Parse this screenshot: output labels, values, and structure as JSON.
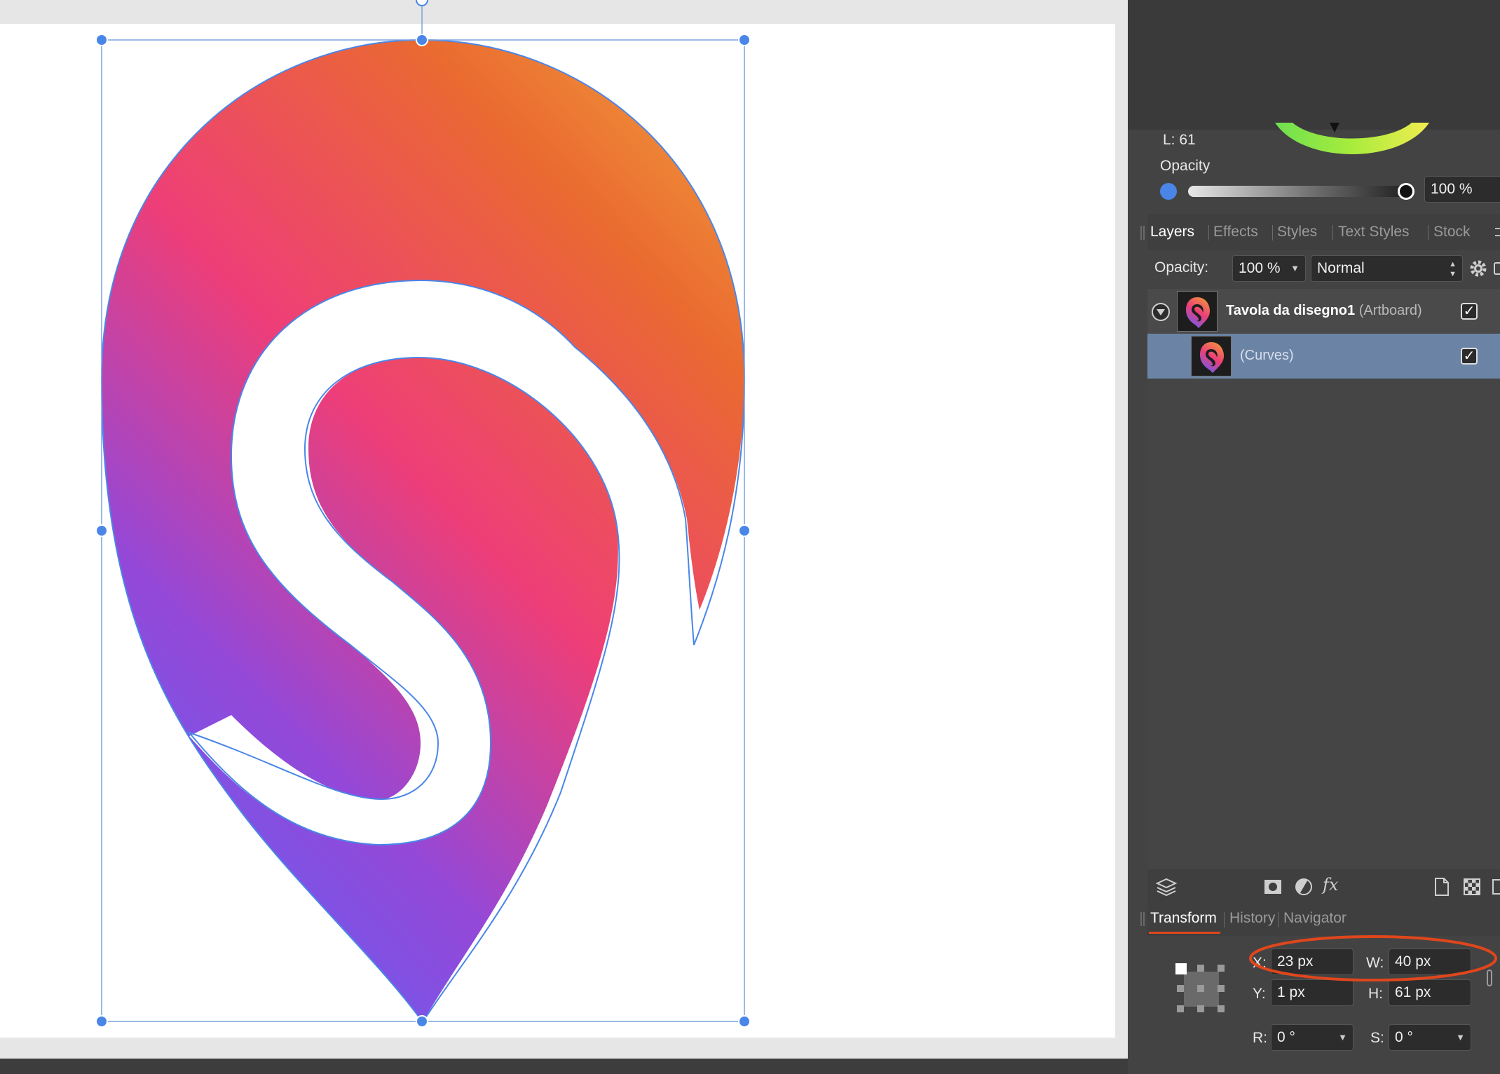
{
  "colors": {
    "accent_blue": "#4a86e8",
    "panel_bg": "#434343",
    "selected_row": "#6b84a6",
    "highlight_ring": "#e0461c",
    "gradient_top": "#f0953a",
    "gradient_mid": "#ee3e78",
    "gradient_bottom": "#6a5cf0"
  },
  "colour": {
    "lightness_label": "L: 61",
    "opacity_label": "Opacity",
    "opacity_value": "100 %"
  },
  "layers_tabs": [
    {
      "label": "Layers",
      "active": true
    },
    {
      "label": "Effects",
      "active": false
    },
    {
      "label": "Styles",
      "active": false
    },
    {
      "label": "Text Styles",
      "active": false
    },
    {
      "label": "Stock",
      "active": false
    }
  ],
  "layers_controls": {
    "opacity_label": "Opacity:",
    "opacity_value": "100 %",
    "blend_mode": "Normal"
  },
  "layers": [
    {
      "name": "Tavola da disegno1",
      "type": "(Artboard)",
      "visible": true,
      "expanded": true
    },
    {
      "name": "",
      "type": "(Curves)",
      "visible": true,
      "selected": true
    }
  ],
  "bottom_icons": [
    "layers-stack-icon",
    "mask-icon",
    "adjustment-icon",
    "fx-icon",
    "new-document-icon",
    "checkerboard-icon",
    "trash-icon"
  ],
  "transform_tabs": [
    {
      "label": "Transform",
      "active": true
    },
    {
      "label": "History",
      "active": false
    },
    {
      "label": "Navigator",
      "active": false
    }
  ],
  "transform": {
    "x_label": "X:",
    "x_value": "23 px",
    "w_label": "W:",
    "w_value": "40 px",
    "y_label": "Y:",
    "y_value": "1 px",
    "h_label": "H:",
    "h_value": "61 px",
    "r_label": "R:",
    "r_value": "0 °",
    "s_label": "S:",
    "s_value": "0 °"
  }
}
